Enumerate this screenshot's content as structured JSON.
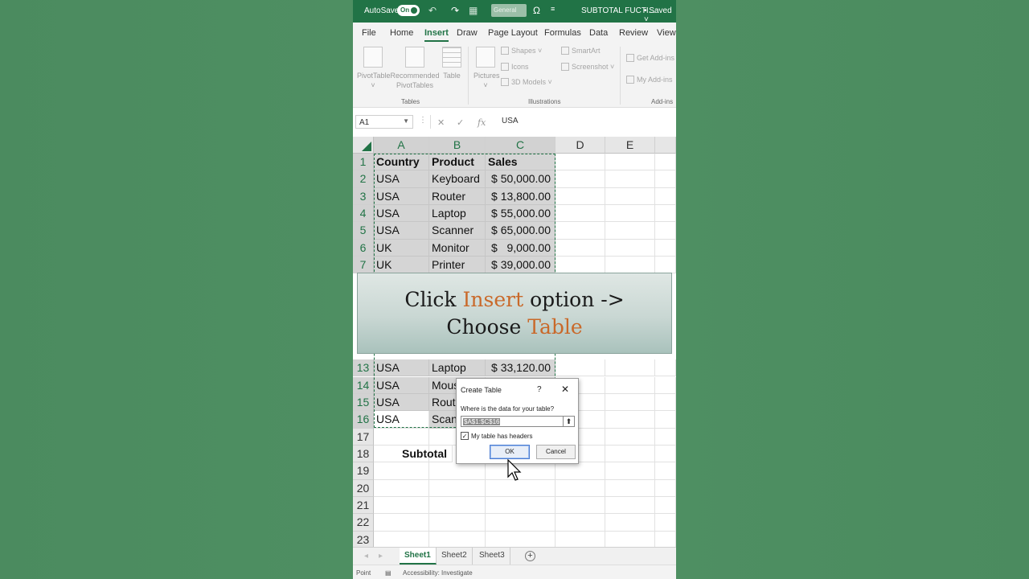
{
  "titlebar": {
    "autosave_label": "AutoSave",
    "toggle_state": "On",
    "number_format": "General",
    "doc_name": "SUBTOTAL FUCTI...",
    "save_status": "• Saved ˅"
  },
  "menu": {
    "items": [
      "File",
      "Home",
      "Insert",
      "Draw",
      "Page Layout",
      "Formulas",
      "Data",
      "Review",
      "View"
    ],
    "active": "Insert"
  },
  "ribbon": {
    "pivottable": "PivotTable",
    "recommended": "Recommended PivotTables",
    "table": "Table",
    "pictures": "Pictures",
    "shapes": "Shapes",
    "icons": "Icons",
    "models": "3D Models",
    "smartart": "SmartArt",
    "screenshot": "Screenshot",
    "get_addins": "Get Add-ins",
    "my_addins": "My Add-ins",
    "group_tables": "Tables",
    "group_illustrations": "Illustrations",
    "group_addins": "Add-ins"
  },
  "formula_bar": {
    "name_box": "A1",
    "value": "USA"
  },
  "columns": [
    "A",
    "B",
    "C",
    "D",
    "E"
  ],
  "rows": [
    {
      "n": "1",
      "a": "Country",
      "b": "Product",
      "c": "Sales",
      "header": true
    },
    {
      "n": "2",
      "a": "USA",
      "b": "Keyboard",
      "cur": "$",
      "amt": "50,000.00"
    },
    {
      "n": "3",
      "a": "USA",
      "b": "Router",
      "cur": "$",
      "amt": "13,800.00"
    },
    {
      "n": "4",
      "a": "USA",
      "b": "Laptop",
      "cur": "$",
      "amt": "55,000.00"
    },
    {
      "n": "5",
      "a": "USA",
      "b": "Scanner",
      "cur": "$",
      "amt": "65,000.00"
    },
    {
      "n": "6",
      "a": "UK",
      "b": "Monitor",
      "cur": "$",
      "amt": "9,000.00"
    },
    {
      "n": "7",
      "a": "UK",
      "b": "Printer",
      "cur": "$",
      "amt": "39,000.00"
    },
    {
      "n": "13",
      "a": "USA",
      "b": "Laptop",
      "cur": "$",
      "amt": "33,120.00"
    },
    {
      "n": "14",
      "a": "USA",
      "b": "Mous"
    },
    {
      "n": "15",
      "a": "USA",
      "b": "Route"
    },
    {
      "n": "16",
      "a": "USA",
      "b": "Scann"
    },
    {
      "n": "17"
    },
    {
      "n": "18",
      "b": "Subtotal"
    },
    {
      "n": "19"
    },
    {
      "n": "20"
    },
    {
      "n": "21"
    },
    {
      "n": "22"
    },
    {
      "n": "23"
    }
  ],
  "overlay": {
    "line1_pre": "Click ",
    "line1_acc": "Insert",
    "line1_post": " option ->",
    "line2_pre": "Choose ",
    "line2_acc": "Table"
  },
  "dialog": {
    "title": "Create Table",
    "help": "?",
    "close": "✕",
    "prompt": "Where is the data for your table?",
    "range": "$A$1:$C$16",
    "checkbox_label": "My table has headers",
    "checked": true,
    "ok": "OK",
    "cancel": "Cancel"
  },
  "sheets": [
    "Sheet1",
    "Sheet2",
    "Sheet3"
  ],
  "active_sheet": "Sheet1",
  "status": {
    "mode": "Point",
    "accessibility": "Accessibility: Investigate"
  },
  "colors": {
    "accent": "#217346",
    "overlay_accent": "#c9692a"
  }
}
